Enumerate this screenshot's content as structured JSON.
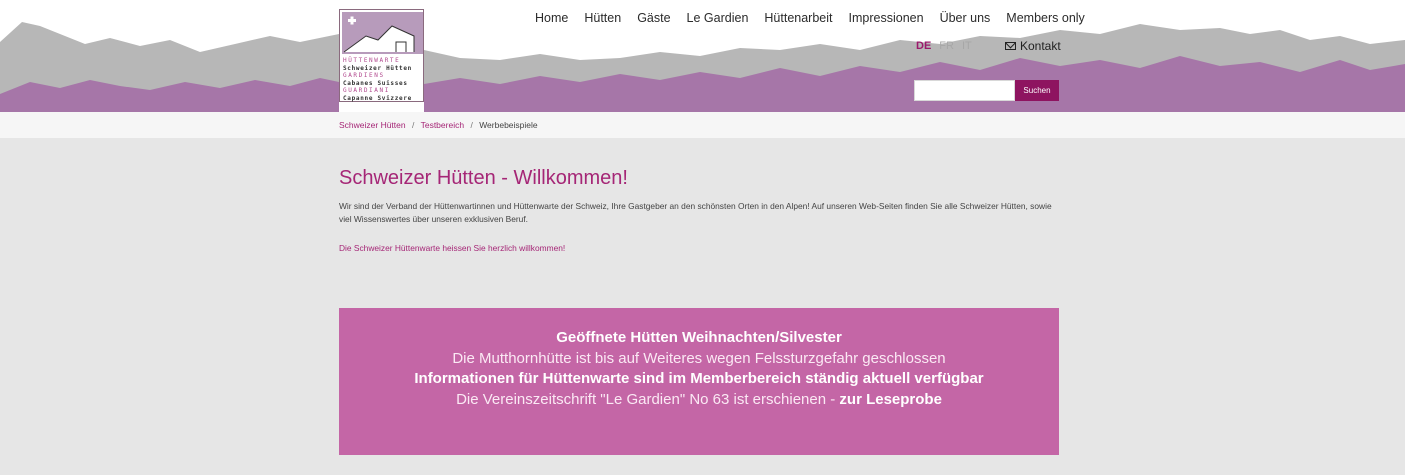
{
  "colors": {
    "accent": "#a52676",
    "search_button": "#8e1460",
    "notice_background": "#c466a6",
    "mountain_gray": "#b3b3b3",
    "mountain_purple": "#a676a8"
  },
  "logo": {
    "icon": "hut-cross-logo-icon",
    "lines": [
      "HÜTTENWARTE",
      "Schweizer Hütten",
      "GARDIENS",
      "Cabanes Suisses",
      "GUARDIANI",
      "Capanne Svizzere"
    ]
  },
  "nav": {
    "items": [
      "Home",
      "Hütten",
      "Gäste",
      "Le Gardien",
      "Hüttenarbeit",
      "Impressionen",
      "Über uns",
      "Members only"
    ]
  },
  "languages": [
    {
      "code": "DE",
      "active": true
    },
    {
      "code": "FR",
      "active": false
    },
    {
      "code": "IT",
      "active": false
    }
  ],
  "contact": {
    "label": "Kontakt",
    "icon": "mail-icon"
  },
  "search": {
    "placeholder": "",
    "button_label": "Suchen"
  },
  "breadcrumb": [
    "Schweizer Hütten",
    "Testbereich",
    "Werbebeispiele"
  ],
  "main": {
    "title": "Schweizer Hütten - Willkommen!",
    "intro": "Wir sind der Verband der Hüttenwartinnen und Hüttenwarte der Schweiz, Ihre Gastgeber an den schönsten Orten in den Alpen! Auf unseren Web-Seiten finden Sie alle Schweizer Hütten, sowie viel Wissenswertes über unseren exklusiven Beruf.",
    "welcome": "Die Schweizer Hüttenwarte heissen Sie herzlich willkommen!"
  },
  "notice": {
    "line1": "Geöffnete Hütten Weihnachten/Silvester",
    "line2": "Die Mutthornhütte ist bis auf Weiteres wegen Felssturzgefahr geschlossen",
    "line3": "Informationen für Hüttenwarte sind im Memberbereich ständig aktuell verfügbar",
    "line4_text": "Die Vereinszeitschrift \"Le Gardien\" No 63 ist erschienen",
    "line4_sep": " - ",
    "line4_link": "zur Leseprobe"
  }
}
